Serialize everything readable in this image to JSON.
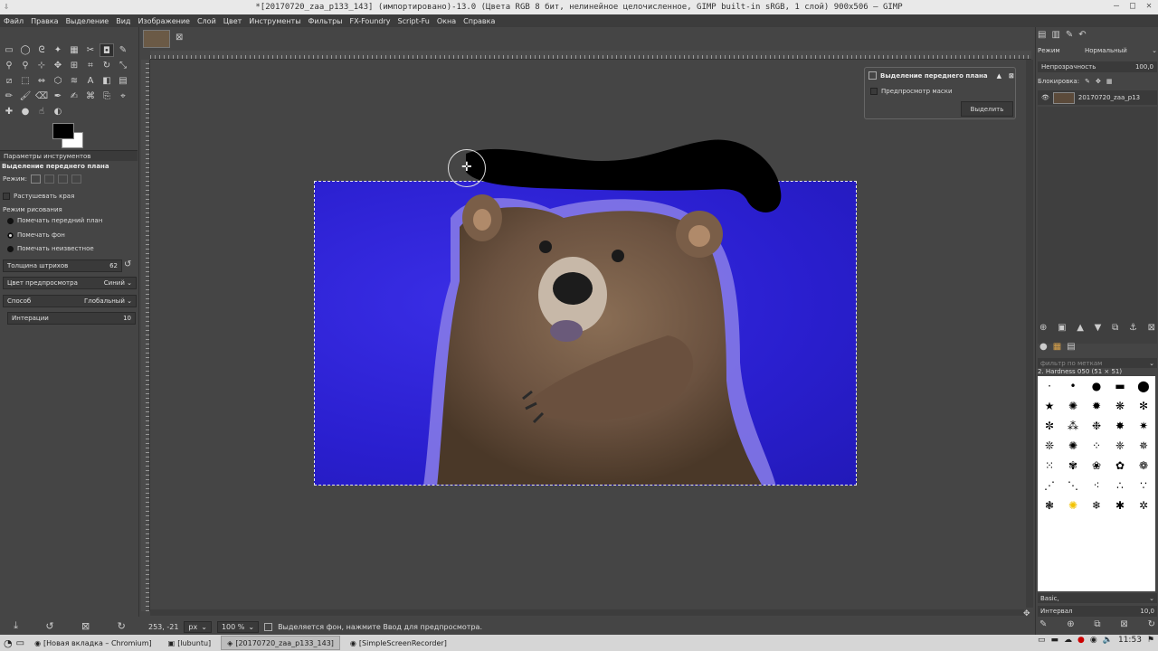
{
  "window": {
    "title": "*[20170720_zaa_p133_143] (импортировано)-13.0 (Цвета RGB 8 бит, нелинейное целочисленное, GIMP built-in sRGB, 1 слой) 900x506 – GIMP"
  },
  "menu": [
    "Файл",
    "Правка",
    "Выделение",
    "Вид",
    "Изображение",
    "Слой",
    "Цвет",
    "Инструменты",
    "Фильтры",
    "FX-Foundry",
    "Script-Fu",
    "Окна",
    "Справка"
  ],
  "tool_options": {
    "tab_label": "Параметры инструментов",
    "tool_title": "Выделение переднего плана",
    "mode_label": "Режим:",
    "feather_label": "Растушевать края",
    "draw_mode_label": "Режим рисования",
    "draw_modes": [
      "Помечать передний план",
      "Помечать фон",
      "Помечать неизвестное"
    ],
    "draw_mode_selected": "Помечать фон",
    "stroke_width_label": "Толщина штрихов",
    "stroke_width_value": "62",
    "preview_color_label": "Цвет предпросмотра",
    "preview_color_value": "Синий",
    "engine_label": "Способ",
    "engine_value": "Глобальный",
    "iterations_label": "Интерации",
    "iterations_value": "10"
  },
  "fg_dialog": {
    "title": "Выделение переднего плана",
    "preview_mask_label": "Предпросмотр маски",
    "select_button": "Выделить"
  },
  "status": {
    "coords": "253, -21",
    "unit": "px",
    "zoom": "100 %",
    "message": "Выделяется фон, нажмите Ввод для предпросмотра."
  },
  "layers": {
    "mode_label": "Режим",
    "mode_value": "Нормальный",
    "opacity_label": "Непрозрачность",
    "opacity_value": "100,0",
    "lock_label": "Блокировка:",
    "layer_name": "20170720_zaa_p13"
  },
  "brushes": {
    "filter_placeholder": "фильтр по меткам",
    "current_brush": "2. Hardness 050 (51 × 51)",
    "preset": "Basic,",
    "spacing_label": "Интервал",
    "spacing_value": "10,0"
  },
  "taskbar": {
    "items": [
      "[Новая вкладка – Chromium]",
      "[lubuntu]",
      "[20170720_zaa_p133_143]",
      "[SimpleScreenRecorder]"
    ],
    "active_index": 2,
    "clock": "11:53"
  },
  "colors": {
    "bg_dark": "#454545",
    "selection_blue": "#2a1fcf"
  }
}
